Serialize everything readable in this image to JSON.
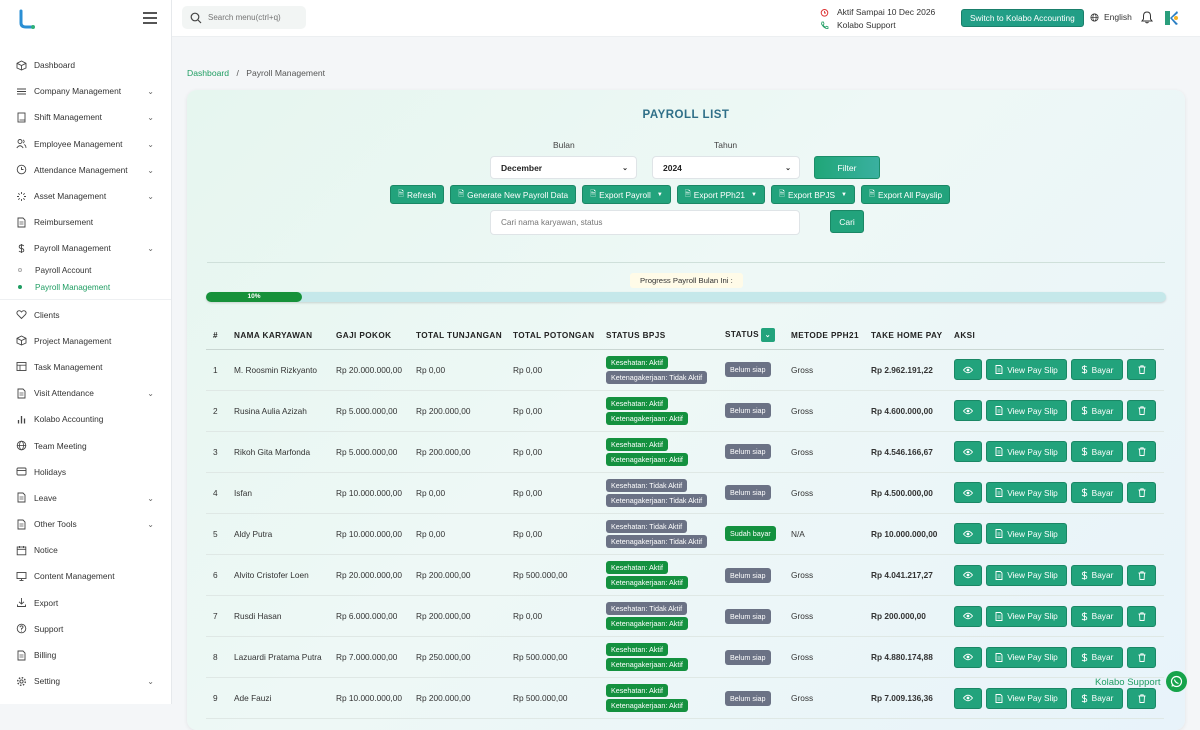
{
  "search": {
    "placeholder": "Search menu(ctrl+q)"
  },
  "topbar": {
    "aktif": "Aktif Sampai 10 Dec 2026",
    "support": "Kolabo Support",
    "switch_label": "Switch to Kolabo Accounting",
    "language": "English"
  },
  "sidebar": {
    "items": [
      {
        "label": "Dashboard"
      },
      {
        "label": "Company Management"
      },
      {
        "label": "Shift Management"
      },
      {
        "label": "Employee Management"
      },
      {
        "label": "Attendance Management"
      },
      {
        "label": "Asset Management"
      },
      {
        "label": "Reimbursement"
      },
      {
        "label": "Payroll Management"
      },
      {
        "label": "Clients"
      },
      {
        "label": "Project Management"
      },
      {
        "label": "Task Management"
      },
      {
        "label": "Visit Attendance"
      },
      {
        "label": "Kolabo Accounting"
      },
      {
        "label": "Team Meeting"
      },
      {
        "label": "Holidays"
      },
      {
        "label": "Leave"
      },
      {
        "label": "Other Tools"
      },
      {
        "label": "Notice"
      },
      {
        "label": "Content Management"
      },
      {
        "label": "Export"
      },
      {
        "label": "Support"
      },
      {
        "label": "Billing"
      },
      {
        "label": "Setting"
      }
    ],
    "sub": [
      {
        "label": "Payroll Account"
      },
      {
        "label": "Payroll Management"
      }
    ]
  },
  "breadcrumb": {
    "home": "Dashboard",
    "sep": "/",
    "current": "Payroll Management"
  },
  "page": {
    "title": "PAYROLL LIST",
    "bulan_label": "Bulan",
    "bulan_value": "December",
    "tahun_label": "Tahun",
    "tahun_value": "2024",
    "filter": "Filter",
    "search_placeholder": "Cari nama karyawan, status",
    "cari": "Cari",
    "progress_label": "Progress Payroll Bulan Ini :",
    "progress_value": "10%",
    "progress_fraction": 0.1
  },
  "buttons": {
    "refresh": "Refresh",
    "generate": "Generate New Payroll Data",
    "export_payroll": "Export Payroll",
    "export_pph21": "Export PPh21",
    "export_bpjs": "Export BPJS",
    "export_all": "Export All Payslip"
  },
  "table": {
    "headers": [
      "#",
      "NAMA KARYAWAN",
      "GAJI POKOK",
      "TOTAL TUNJANGAN",
      "TOTAL POTONGAN",
      "STATUS BPJS",
      "STATUS",
      "METODE PPH21",
      "TAKE HOME PAY",
      "AKSI"
    ],
    "view_label": "View Pay Slip",
    "bayar_label": "Bayar",
    "rows": [
      {
        "no": "1",
        "nama": "M. Roosmin Rizkyanto",
        "gaji": "Rp 20.000.000,00",
        "tunjangan": "Rp 0,00",
        "potongan": "Rp 0,00",
        "kes": "Kesehatan: Aktif",
        "ket": "Ketenagakerjaan: Tidak Aktif",
        "status": "Belum siap",
        "metode": "Gross",
        "thp": "Rp 2.962.191,22"
      },
      {
        "no": "2",
        "nama": "Rusina Aulia Azizah",
        "gaji": "Rp 5.000.000,00",
        "tunjangan": "Rp 200.000,00",
        "potongan": "Rp 0,00",
        "kes": "Kesehatan: Aktif",
        "ket": "Ketenagakerjaan: Aktif",
        "status": "Belum siap",
        "metode": "Gross",
        "thp": "Rp 4.600.000,00"
      },
      {
        "no": "3",
        "nama": "Rikoh Gita Marfonda",
        "gaji": "Rp 5.000.000,00",
        "tunjangan": "Rp 200.000,00",
        "potongan": "Rp 0,00",
        "kes": "Kesehatan: Aktif",
        "ket": "Ketenagakerjaan: Aktif",
        "status": "Belum siap",
        "metode": "Gross",
        "thp": "Rp 4.546.166,67"
      },
      {
        "no": "4",
        "nama": "Isfan",
        "gaji": "Rp 10.000.000,00",
        "tunjangan": "Rp 0,00",
        "potongan": "Rp 0,00",
        "kes": "Kesehatan: Tidak Aktif",
        "ket": "Ketenagakerjaan: Tidak Aktif",
        "status": "Belum siap",
        "metode": "Gross",
        "thp": "Rp 4.500.000,00"
      },
      {
        "no": "5",
        "nama": "Aldy Putra",
        "gaji": "Rp 10.000.000,00",
        "tunjangan": "Rp 0,00",
        "potongan": "Rp 0,00",
        "kes": "Kesehatan: Tidak Aktif",
        "ket": "Ketenagakerjaan: Tidak Aktif",
        "status": "Sudah bayar",
        "metode": "N/A",
        "thp": "Rp 10.000.000,00"
      },
      {
        "no": "6",
        "nama": "Alvito Cristofer Loen",
        "gaji": "Rp 20.000.000,00",
        "tunjangan": "Rp 200.000,00",
        "potongan": "Rp 500.000,00",
        "kes": "Kesehatan: Aktif",
        "ket": "Ketenagakerjaan: Aktif",
        "status": "Belum siap",
        "metode": "Gross",
        "thp": "Rp 4.041.217,27"
      },
      {
        "no": "7",
        "nama": "Rusdi Hasan",
        "gaji": "Rp 6.000.000,00",
        "tunjangan": "Rp 200.000,00",
        "potongan": "Rp 0,00",
        "kes": "Kesehatan: Tidak Aktif",
        "ket": "Ketenagakerjaan: Aktif",
        "status": "Belum siap",
        "metode": "Gross",
        "thp": "Rp 200.000,00"
      },
      {
        "no": "8",
        "nama": "Lazuardi Pratama Putra",
        "gaji": "Rp 7.000.000,00",
        "tunjangan": "Rp 250.000,00",
        "potongan": "Rp 500.000,00",
        "kes": "Kesehatan: Aktif",
        "ket": "Ketenagakerjaan: Aktif",
        "status": "Belum siap",
        "metode": "Gross",
        "thp": "Rp 4.880.174,88"
      },
      {
        "no": "9",
        "nama": "Ade Fauzi",
        "gaji": "Rp 10.000.000,00",
        "tunjangan": "Rp 200.000,00",
        "potongan": "Rp 500.000,00",
        "kes": "Kesehatan: Aktif",
        "ket": "Ketenagakerjaan: Aktif",
        "status": "Belum siap",
        "metode": "Gross",
        "thp": "Rp 7.009.136,36"
      }
    ]
  },
  "floating": {
    "kolabo_support": "Kolabo Support"
  },
  "colors": {
    "primary": "#22a37c",
    "active_badge": "#14913f",
    "inactive_badge": "#6b7285",
    "title": "#2f6f88"
  },
  "icons": {
    "sidebar": [
      "cube-icon",
      "list-icon",
      "book-icon",
      "users-icon",
      "clock-icon",
      "loader-icon",
      "document-icon",
      "dollar-icon",
      "heart-icon",
      "cube-icon",
      "table-icon",
      "document-icon",
      "chart-icon",
      "globe-icon",
      "card-icon",
      "document-icon",
      "document-icon",
      "calendar-icon",
      "monitor-icon",
      "download-icon",
      "help-icon",
      "document-icon",
      "gear-icon"
    ]
  }
}
